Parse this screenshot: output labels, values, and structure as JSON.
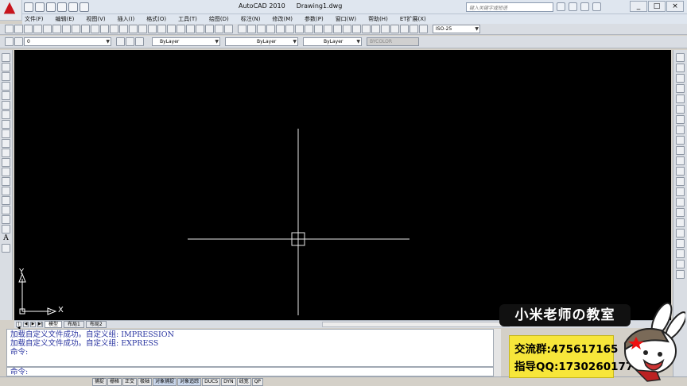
{
  "window": {
    "app_name": "AutoCAD 2010",
    "file_name": "Drawing1.dwg",
    "search_placeholder": "键入关键字或短语",
    "buttons": [
      "_",
      "□",
      "×"
    ]
  },
  "menu": [
    "文件(F)",
    "编辑(E)",
    "视图(V)",
    "插入(I)",
    "格式(O)",
    "工具(T)",
    "绘图(D)",
    "标注(N)",
    "修改(M)",
    "参数(P)",
    "窗口(W)",
    "帮助(H)",
    "ET扩展(X)"
  ],
  "toolbar": {
    "dim_style": "ISO-25",
    "layer_value": "0",
    "color": "ByLayer",
    "linetype": "ByLayer",
    "lineweight": "ByLayer",
    "plotstyle": "BYCOLOR"
  },
  "left_toolbar": {
    "text_icon": "A"
  },
  "ucs": {
    "y_label": "Y",
    "x_label": "X"
  },
  "layout_tabs": {
    "nav": [
      "|◀",
      "◀",
      "▶",
      "▶|"
    ],
    "tabs": [
      "模型",
      "布局1",
      "布局2"
    ],
    "active": 0
  },
  "command_line": {
    "lines": [
      "加载自定义文件成功。自定义组: IMPRESSION",
      "加载自定义文件成功。自定义组: EXPRESS",
      "命令:"
    ],
    "prompt": "命令:"
  },
  "statusbar": {
    "coords": "",
    "toggles": [
      "捕捉",
      "栅格",
      "正交",
      "极轴",
      "对象捕捉",
      "对象追踪",
      "DUCS",
      "DYN",
      "线宽",
      "QP"
    ],
    "active_toggles": [
      4,
      5
    ]
  },
  "branding": {
    "title": "小米老师の教室",
    "group": "交流群:475617165",
    "qq": "指导QQ:1730260177"
  },
  "colors": {
    "canvas_bg": "#000000",
    "command_text": "#2833a0",
    "brand_yellow": "#f7e63a"
  }
}
